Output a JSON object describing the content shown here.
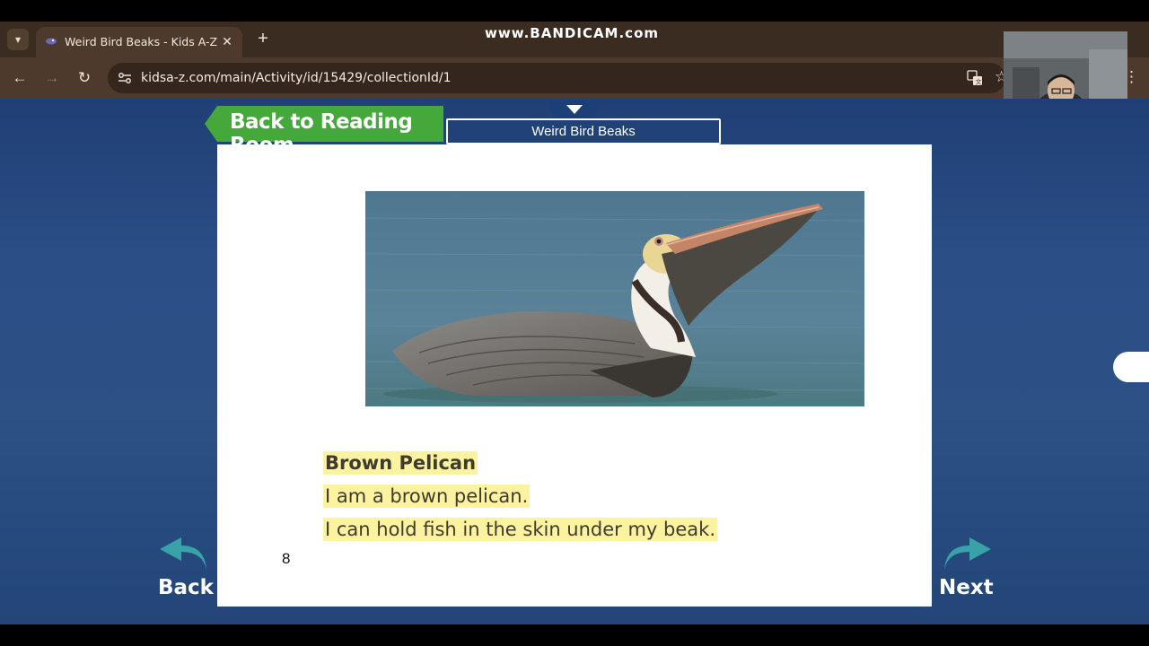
{
  "browser": {
    "tab_title": "Weird Bird Beaks - Kids A-Z",
    "new_tab_symbol": "+",
    "close_symbol": "✕",
    "url": "kidsa-z.com/main/Activity/id/15429/collectionId/1",
    "watermark": "www.BANDICAM.com"
  },
  "page": {
    "back_to_reading_room": "Back to Reading Room",
    "book_title": "Weird Bird Beaks",
    "heading": "Brown Pelican",
    "line1": "I am a brown pelican.",
    "line2": "I can hold fish in the skin under my beak.",
    "page_number": "8",
    "back_label": "Back",
    "next_label": "Next"
  },
  "colors": {
    "page_bg": "#2b4e86",
    "back_button_green": "#44a83b",
    "text_highlight": "#fbf3a0",
    "nav_arrow_teal": "#38a2a8"
  },
  "icons": [
    "tab-search-icon",
    "reload-icon",
    "back-arrow-icon",
    "forward-arrow-icon",
    "site-info-icon",
    "translate-icon",
    "bookmark-star-icon",
    "more-menu-icon"
  ]
}
